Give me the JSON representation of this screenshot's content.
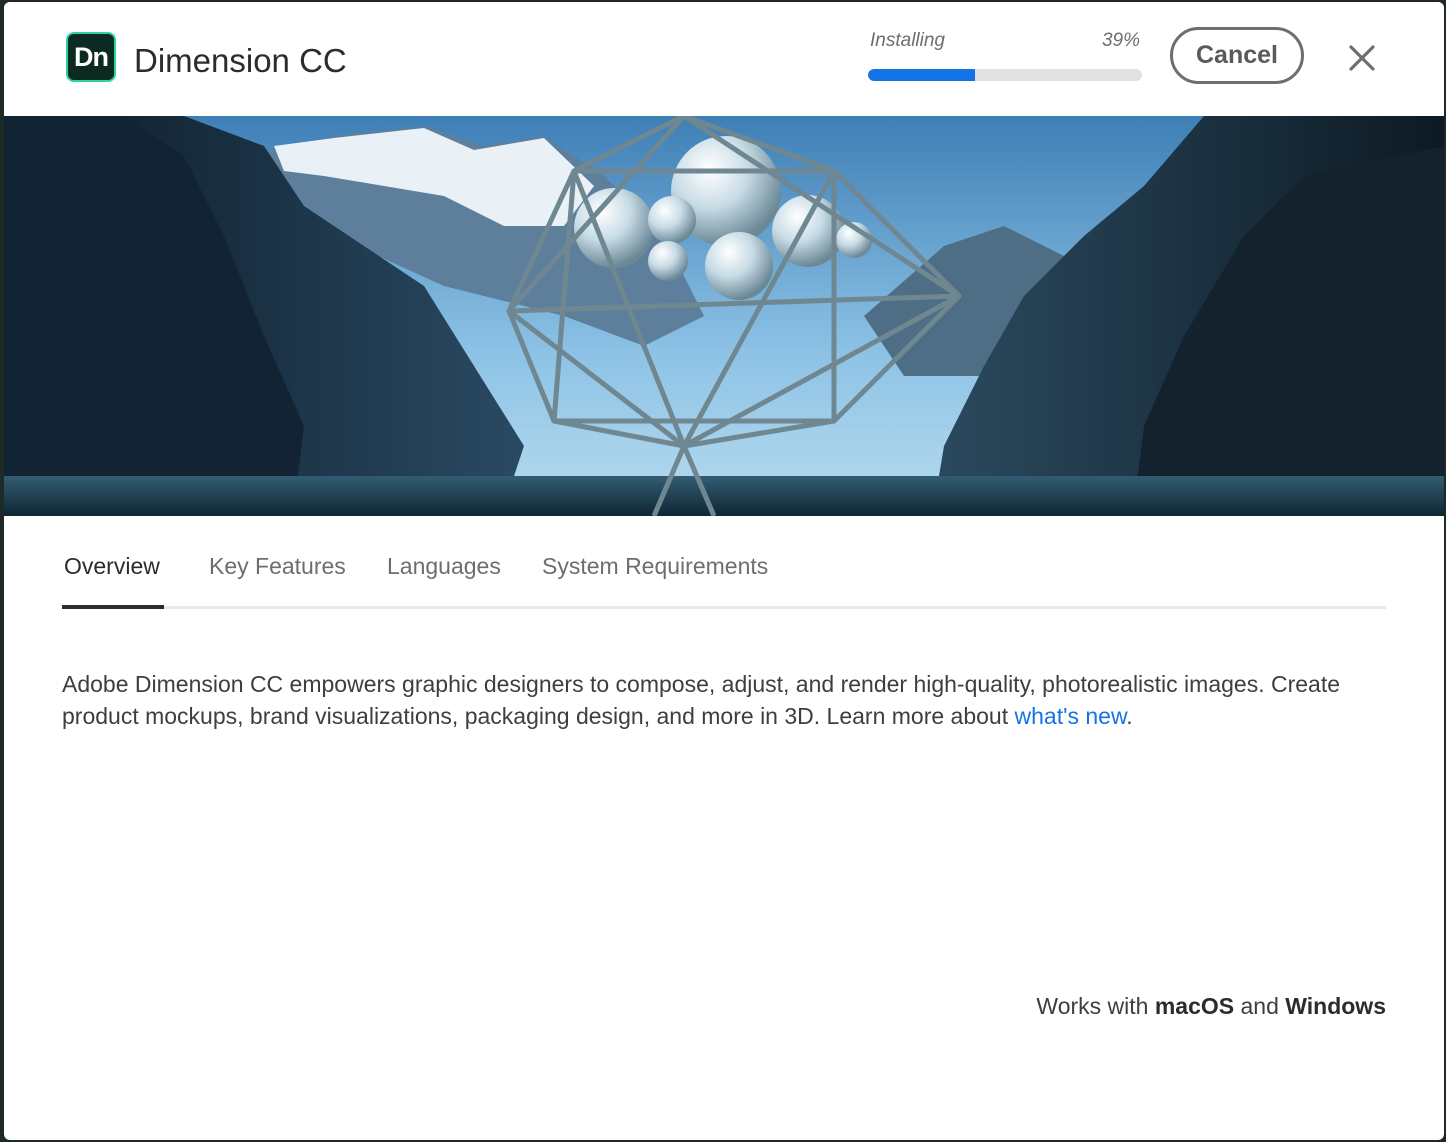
{
  "header": {
    "app_logo_text": "Dn",
    "app_title": "Dimension CC",
    "install_status": "Installing",
    "install_percent": "39%",
    "progress_value": 0.39,
    "cancel_label": "Cancel"
  },
  "tabs": [
    {
      "label": "Overview",
      "active": true
    },
    {
      "label": "Key Features",
      "active": false
    },
    {
      "label": "Languages",
      "active": false
    },
    {
      "label": "System Requirements",
      "active": false
    }
  ],
  "overview": {
    "text": "Adobe Dimension CC empowers graphic designers to compose, adjust, and render high-quality, photorealistic images. Create product mockups, brand visualizations, packaging design, and more in 3D. Learn more about ",
    "link_text": "what's new",
    "after_link": "."
  },
  "platforms": {
    "prefix": "Works with ",
    "os1": "macOS",
    "middle": " and ",
    "os2": "Windows"
  },
  "colors": {
    "accent": "#1473e6",
    "logo_bg": "#0b2b22",
    "logo_border": "#2fd19f",
    "progress_track": "#e1e1e1"
  }
}
